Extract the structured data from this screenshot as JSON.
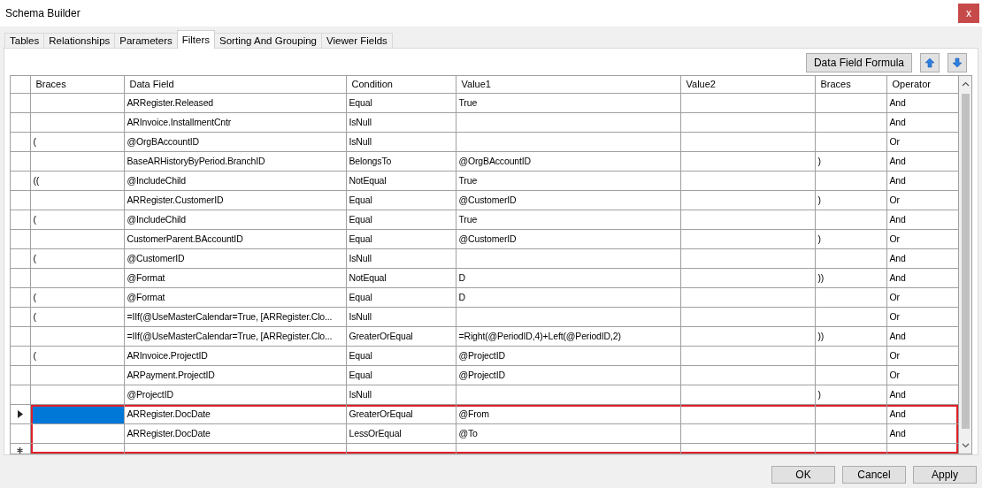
{
  "window": {
    "title": "Schema Builder",
    "close": "x"
  },
  "tabs": [
    {
      "label": "Tables",
      "selected": false
    },
    {
      "label": "Relationships",
      "selected": false
    },
    {
      "label": "Parameters",
      "selected": false
    },
    {
      "label": "Filters",
      "selected": true
    },
    {
      "label": "Sorting And Grouping",
      "selected": false
    },
    {
      "label": "Viewer Fields",
      "selected": false
    }
  ],
  "toolbar": {
    "formula_button": "Data Field Formula"
  },
  "table": {
    "columns": [
      "Braces",
      "Data Field",
      "Condition",
      "Value1",
      "Value2",
      "Braces",
      "Operator"
    ],
    "rows": [
      {
        "cells": [
          "",
          "ARRegister.Released",
          "Equal",
          "True",
          "",
          "",
          "And"
        ],
        "current": false,
        "highlighted": false
      },
      {
        "cells": [
          "",
          "ARInvoice.InstallmentCntr",
          "IsNull",
          "",
          "",
          "",
          "And"
        ],
        "current": false,
        "highlighted": false
      },
      {
        "cells": [
          "(",
          "@OrgBAccountID",
          "IsNull",
          "",
          "",
          "",
          "Or"
        ],
        "current": false,
        "highlighted": false
      },
      {
        "cells": [
          "",
          "BaseARHistoryByPeriod.BranchID",
          "BelongsTo",
          "@OrgBAccountID",
          "",
          ")",
          "And"
        ],
        "current": false,
        "highlighted": false
      },
      {
        "cells": [
          "((",
          "@IncludeChild",
          "NotEqual",
          "True",
          "",
          "",
          "And"
        ],
        "current": false,
        "highlighted": false
      },
      {
        "cells": [
          "",
          "ARRegister.CustomerID",
          "Equal",
          "@CustomerID",
          "",
          ")",
          "Or"
        ],
        "current": false,
        "highlighted": false
      },
      {
        "cells": [
          "(",
          "@IncludeChild",
          "Equal",
          "True",
          "",
          "",
          "And"
        ],
        "current": false,
        "highlighted": false
      },
      {
        "cells": [
          "",
          "CustomerParent.BAccountID",
          "Equal",
          "@CustomerID",
          "",
          ")",
          "Or"
        ],
        "current": false,
        "highlighted": false
      },
      {
        "cells": [
          "(",
          "@CustomerID",
          "IsNull",
          "",
          "",
          "",
          "And"
        ],
        "current": false,
        "highlighted": false
      },
      {
        "cells": [
          "",
          "@Format",
          "NotEqual",
          "D",
          "",
          "))",
          "And"
        ],
        "current": false,
        "highlighted": false
      },
      {
        "cells": [
          "(",
          "@Format",
          "Equal",
          "D",
          "",
          "",
          "Or"
        ],
        "current": false,
        "highlighted": false
      },
      {
        "cells": [
          "(",
          "=IIf(@UseMasterCalendar=True, [ARRegister.Clo...",
          "IsNull",
          "",
          "",
          "",
          "Or"
        ],
        "current": false,
        "highlighted": false
      },
      {
        "cells": [
          "",
          "=IIf(@UseMasterCalendar=True, [ARRegister.Clo...",
          "GreaterOrEqual",
          "=Right(@PeriodID,4)+Left(@PeriodID,2)",
          "",
          "))",
          "And"
        ],
        "current": false,
        "highlighted": false
      },
      {
        "cells": [
          "(",
          "ARInvoice.ProjectID",
          "Equal",
          "@ProjectID",
          "",
          "",
          "Or"
        ],
        "current": false,
        "highlighted": false
      },
      {
        "cells": [
          "",
          "ARPayment.ProjectID",
          "Equal",
          "@ProjectID",
          "",
          "",
          "Or"
        ],
        "current": false,
        "highlighted": false
      },
      {
        "cells": [
          "",
          "@ProjectID",
          "IsNull",
          "",
          "",
          ")",
          "And"
        ],
        "current": false,
        "highlighted": false
      },
      {
        "cells": [
          "",
          "ARRegister.DocDate",
          "GreaterOrEqual",
          "@From",
          "",
          "",
          "And"
        ],
        "current": true,
        "highlighted": true
      },
      {
        "cells": [
          "",
          "ARRegister.DocDate",
          "LessOrEqual",
          "@To",
          "",
          "",
          "And"
        ],
        "current": false,
        "highlighted": true
      }
    ]
  },
  "buttons": [
    "OK",
    "Cancel",
    "Apply"
  ]
}
